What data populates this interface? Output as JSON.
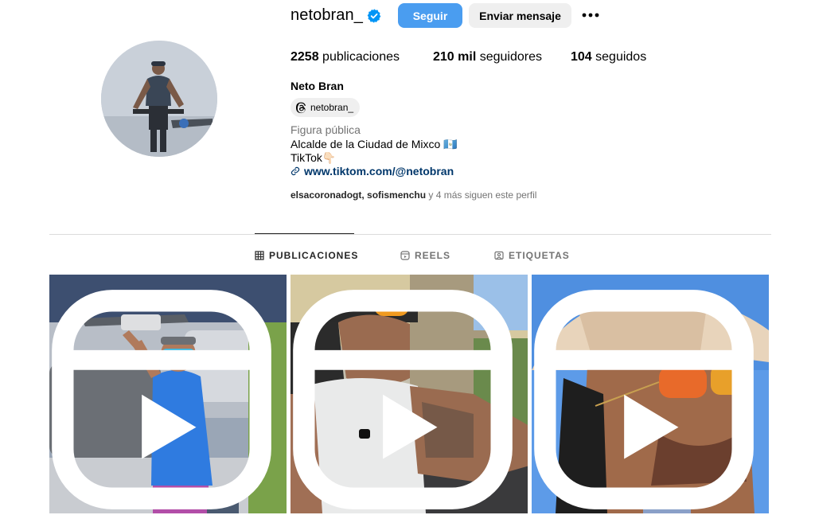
{
  "profile": {
    "username": "netobran_",
    "follow_label": "Seguir",
    "message_label": "Enviar mensaje",
    "more_label": "•••",
    "stats": {
      "posts_count": "2258",
      "posts_label": "publicaciones",
      "followers_count": "210 mil",
      "followers_label": "seguidores",
      "following_count": "104",
      "following_label": "seguidos"
    },
    "full_name": "Neto Bran",
    "threads_handle": "netobran_",
    "category": "Figura pública",
    "bio_line1": "Alcalde de la Ciudad de Mixco 🇬🇹",
    "bio_line2": "TikTok👇🏻",
    "link": "www.tiktom.com/@netobran",
    "followed_by_names": "elsacoronadogt, sofismenchu",
    "followed_by_rest": " y 4 más siguen este perfil"
  },
  "tabs": [
    {
      "label": "PUBLICACIONES",
      "icon": "grid-icon",
      "active": true
    },
    {
      "label": "REELS",
      "icon": "reels-icon",
      "active": false
    },
    {
      "label": "ETIQUETAS",
      "icon": "tagged-icon",
      "active": false
    }
  ],
  "colors": {
    "follow_button": "#4a9df0",
    "secondary_button": "#efefef",
    "link": "#00376b",
    "verified": "#0095f6"
  },
  "posts": [
    {
      "type": "reel",
      "icon": "reel-badge-icon",
      "subject": "man in blue shirt holding drone"
    },
    {
      "type": "reel",
      "icon": "reel-badge-icon",
      "subject": "man in white tank top with sunglasses"
    },
    {
      "type": "reel",
      "icon": "reel-badge-icon",
      "subject": "man in cowboy hat with aviator sunglasses"
    }
  ]
}
